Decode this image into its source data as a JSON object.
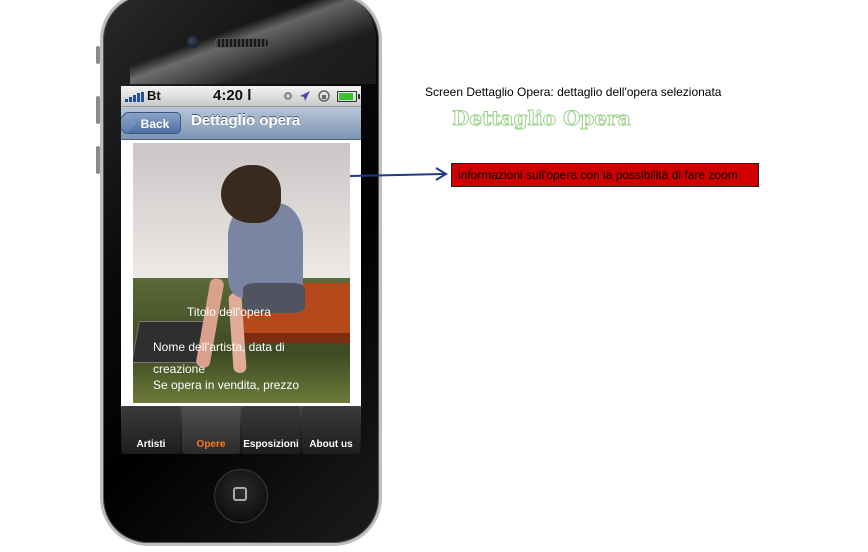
{
  "annotation": {
    "caption": "Screen Dettaglio Opera: dettaglio dell'opera selezionata",
    "outline_title": "Dettaglio Opera",
    "callout": "informazioni sull'opera con la possibilità di fare zoom"
  },
  "statusbar": {
    "carrier": "Bt",
    "time": "4:20 l"
  },
  "navbar": {
    "back_label": "Back",
    "title": "Dettaglio opera"
  },
  "artwork": {
    "title": "Titolo dell'opera",
    "artist_date": "Nome dell'artista, data di creazione",
    "sale": "Se opera in vendita, prezzo"
  },
  "tabbar": {
    "tabs": [
      {
        "label": "Artisti",
        "active": false
      },
      {
        "label": "Opere",
        "active": true
      },
      {
        "label": "Esposizioni",
        "active": false
      },
      {
        "label": "About us",
        "active": false
      }
    ],
    "active_color": "#ff7a1a"
  },
  "colors": {
    "callout_bg": "#d00000",
    "nav_bar": "#7d95b3",
    "arrow": "#1f3a8a"
  },
  "icons": [
    "signal-icon",
    "alarm-icon",
    "location-icon",
    "lock-rotation-icon",
    "battery-icon",
    "home-button-icon",
    "back-arrow-icon"
  ]
}
